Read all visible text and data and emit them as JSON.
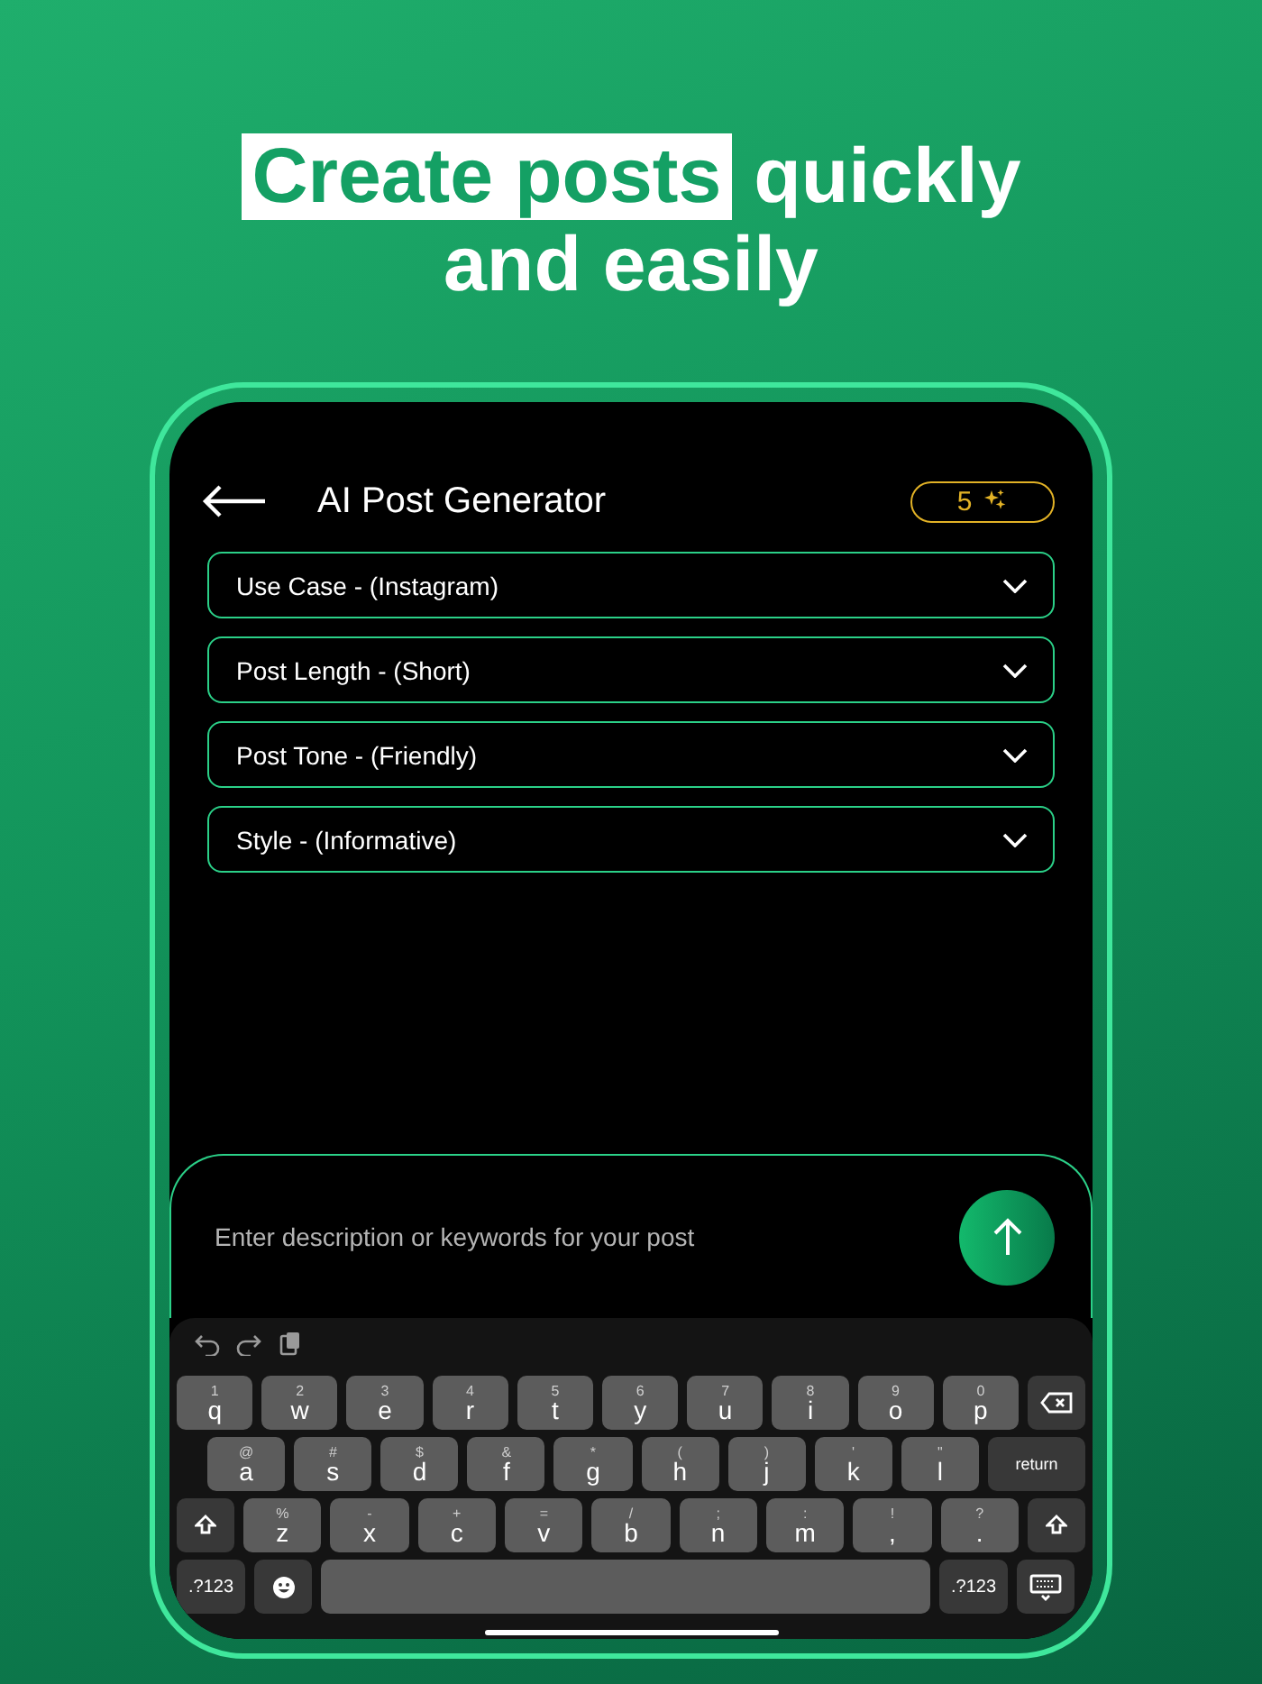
{
  "headline": {
    "highlight": "Create posts",
    "rest": "quickly and easily"
  },
  "header": {
    "title": "AI Post Generator",
    "credits": "5"
  },
  "dropdowns": [
    {
      "label": "Use Case - (Instagram)"
    },
    {
      "label": "Post Length - (Short)"
    },
    {
      "label": "Post Tone - (Friendly)"
    },
    {
      "label": "Style - (Informative)"
    }
  ],
  "prompt": {
    "placeholder": "Enter description or keywords for your post"
  },
  "keyboard": {
    "letter_rows": [
      [
        {
          "kind": "letter",
          "label": "q",
          "hint": "1"
        },
        {
          "kind": "letter",
          "label": "w",
          "hint": "2"
        },
        {
          "kind": "letter",
          "label": "e",
          "hint": "3"
        },
        {
          "kind": "letter",
          "label": "r",
          "hint": "4"
        },
        {
          "kind": "letter",
          "label": "t",
          "hint": "5"
        },
        {
          "kind": "letter",
          "label": "y",
          "hint": "6"
        },
        {
          "kind": "letter",
          "label": "u",
          "hint": "7"
        },
        {
          "kind": "letter",
          "label": "i",
          "hint": "8"
        },
        {
          "kind": "letter",
          "label": "o",
          "hint": "9"
        },
        {
          "kind": "letter",
          "label": "p",
          "hint": "0"
        },
        {
          "kind": "backspace"
        }
      ],
      [
        {
          "kind": "letter",
          "label": "a",
          "hint": "@"
        },
        {
          "kind": "letter",
          "label": "s",
          "hint": "#"
        },
        {
          "kind": "letter",
          "label": "d",
          "hint": "$"
        },
        {
          "kind": "letter",
          "label": "f",
          "hint": "&"
        },
        {
          "kind": "letter",
          "label": "g",
          "hint": "*"
        },
        {
          "kind": "letter",
          "label": "h",
          "hint": "("
        },
        {
          "kind": "letter",
          "label": "j",
          "hint": ")"
        },
        {
          "kind": "letter",
          "label": "k",
          "hint": "'"
        },
        {
          "kind": "letter",
          "label": "l",
          "hint": "\""
        },
        {
          "kind": "return",
          "label": "return"
        }
      ],
      [
        {
          "kind": "shift"
        },
        {
          "kind": "letter",
          "label": "z",
          "hint": "%"
        },
        {
          "kind": "letter",
          "label": "x",
          "hint": "-"
        },
        {
          "kind": "letter",
          "label": "c",
          "hint": "+"
        },
        {
          "kind": "letter",
          "label": "v",
          "hint": "="
        },
        {
          "kind": "letter",
          "label": "b",
          "hint": "/"
        },
        {
          "kind": "letter",
          "label": "n",
          "hint": ";"
        },
        {
          "kind": "letter",
          "label": "m",
          "hint": ":"
        },
        {
          "kind": "letter",
          "label": ",",
          "hint": "!"
        },
        {
          "kind": "letter",
          "label": ".",
          "hint": "?"
        },
        {
          "kind": "shift"
        }
      ]
    ],
    "function_row": {
      "left_mode": ".?123",
      "right_mode": ".?123"
    }
  }
}
